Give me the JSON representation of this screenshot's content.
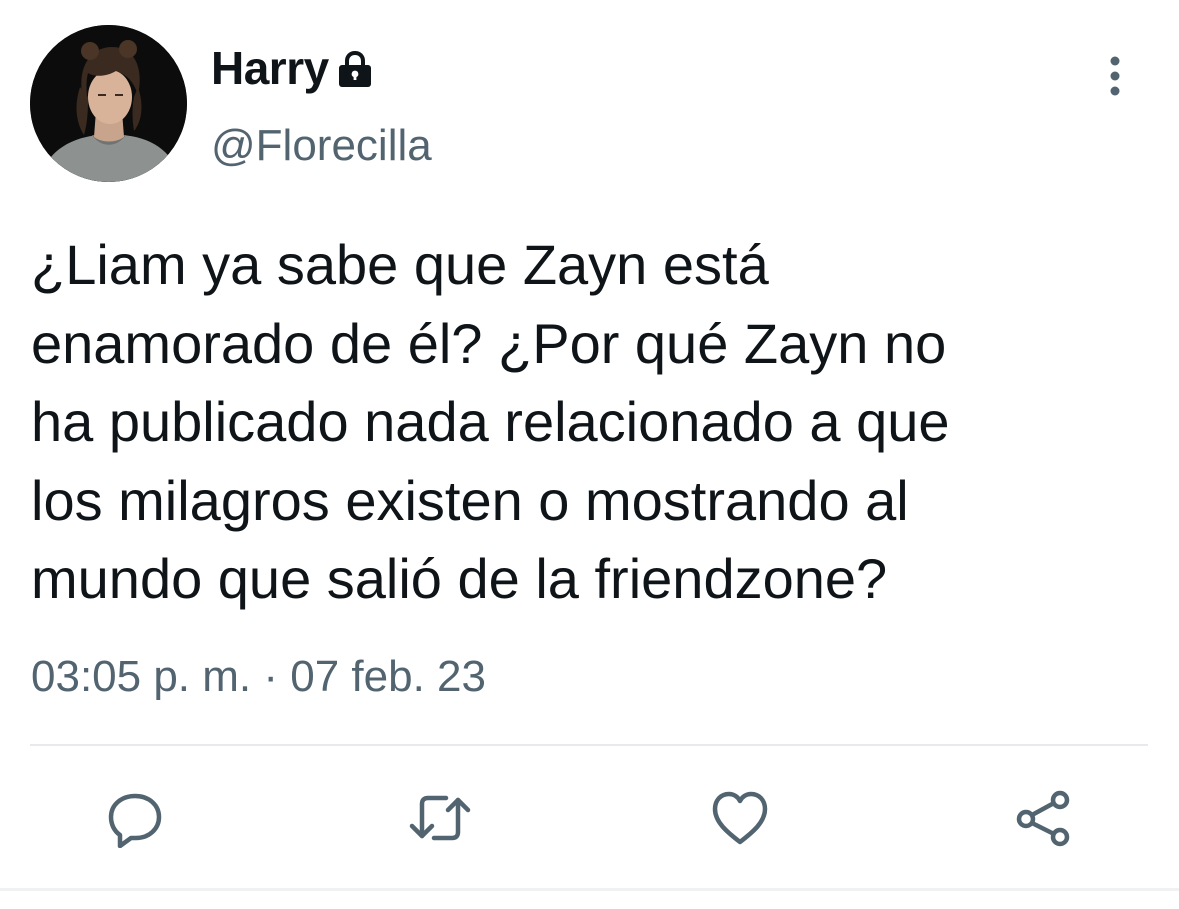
{
  "user": {
    "display_name": "Harry",
    "handle": "@Florecilla",
    "protected_icon": "lock-icon",
    "avatar": "profile-photo"
  },
  "tweet": {
    "text_lines": [
      "¿Liam ya sabe que Zayn está",
      "enamorado de él? ¿Por qué Zayn no",
      "ha publicado nada relacionado a que",
      "los milagros existen o mostrando al",
      "mundo que salió de la friendzone?"
    ],
    "time": "03:05 p. m.",
    "separator": "·",
    "date": "07 feb. 23"
  },
  "actions": [
    {
      "name": "reply",
      "icon": "reply-icon"
    },
    {
      "name": "retweet",
      "icon": "retweet-icon"
    },
    {
      "name": "like",
      "icon": "heart-icon"
    },
    {
      "name": "share",
      "icon": "share-icon"
    }
  ],
  "colors": {
    "text_primary": "#0f1419",
    "text_secondary": "#536471",
    "icon_gray": "#536471",
    "divider": "#e7e9ec"
  }
}
